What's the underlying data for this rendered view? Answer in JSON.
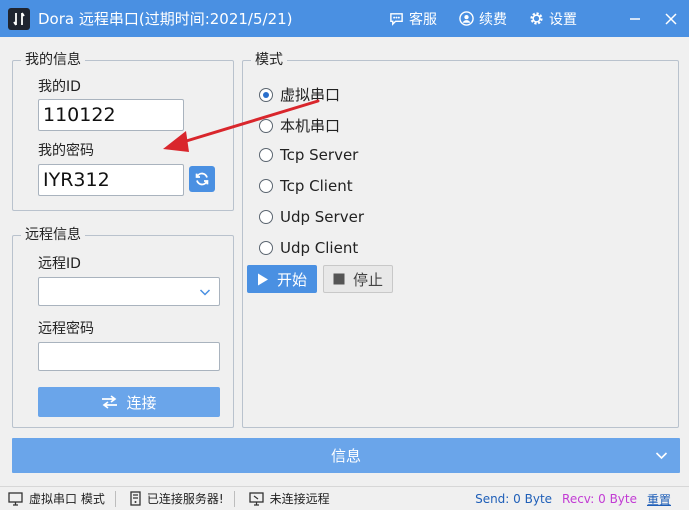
{
  "app": {
    "title": "Dora 远程串口(过期时间:2021/5/21)",
    "colors": {
      "primary": "#4a90e2",
      "primary_light": "#6aa5ea",
      "annotation_arrow": "#d9262c"
    }
  },
  "titlebar": {
    "kefu_label": "客服",
    "xufei_label": "续费",
    "settings_label": "设置",
    "icons": [
      "chat-icon",
      "user-icon",
      "gear-icon",
      "minimize-icon",
      "close-icon"
    ]
  },
  "my_info": {
    "legend": "我的信息",
    "id_label": "我的ID",
    "id_value": "110122",
    "pwd_label": "我的密码",
    "pwd_value": "IYR312"
  },
  "remote_info": {
    "legend": "远程信息",
    "id_label": "远程ID",
    "id_value": "",
    "pwd_label": "远程密码",
    "pwd_value": "",
    "connect_label": "连接"
  },
  "mode": {
    "legend": "模式",
    "options": [
      {
        "label": "虚拟串口",
        "selected": true
      },
      {
        "label": "本机串口",
        "selected": false
      },
      {
        "label": "Tcp Server",
        "selected": false
      },
      {
        "label": "Tcp Client",
        "selected": false
      },
      {
        "label": "Udp Server",
        "selected": false
      },
      {
        "label": "Udp Client",
        "selected": false
      }
    ],
    "start_label": "开始",
    "stop_label": "停止"
  },
  "info_bar": {
    "label": "信息"
  },
  "statusbar": {
    "port_mode": "虚拟串口 模式",
    "server_status": "已连接服务器!",
    "remote_status": "未连接远程",
    "send": "Send: 0 Byte",
    "recv": "Recv: 0 Byte",
    "reset": "重置"
  }
}
